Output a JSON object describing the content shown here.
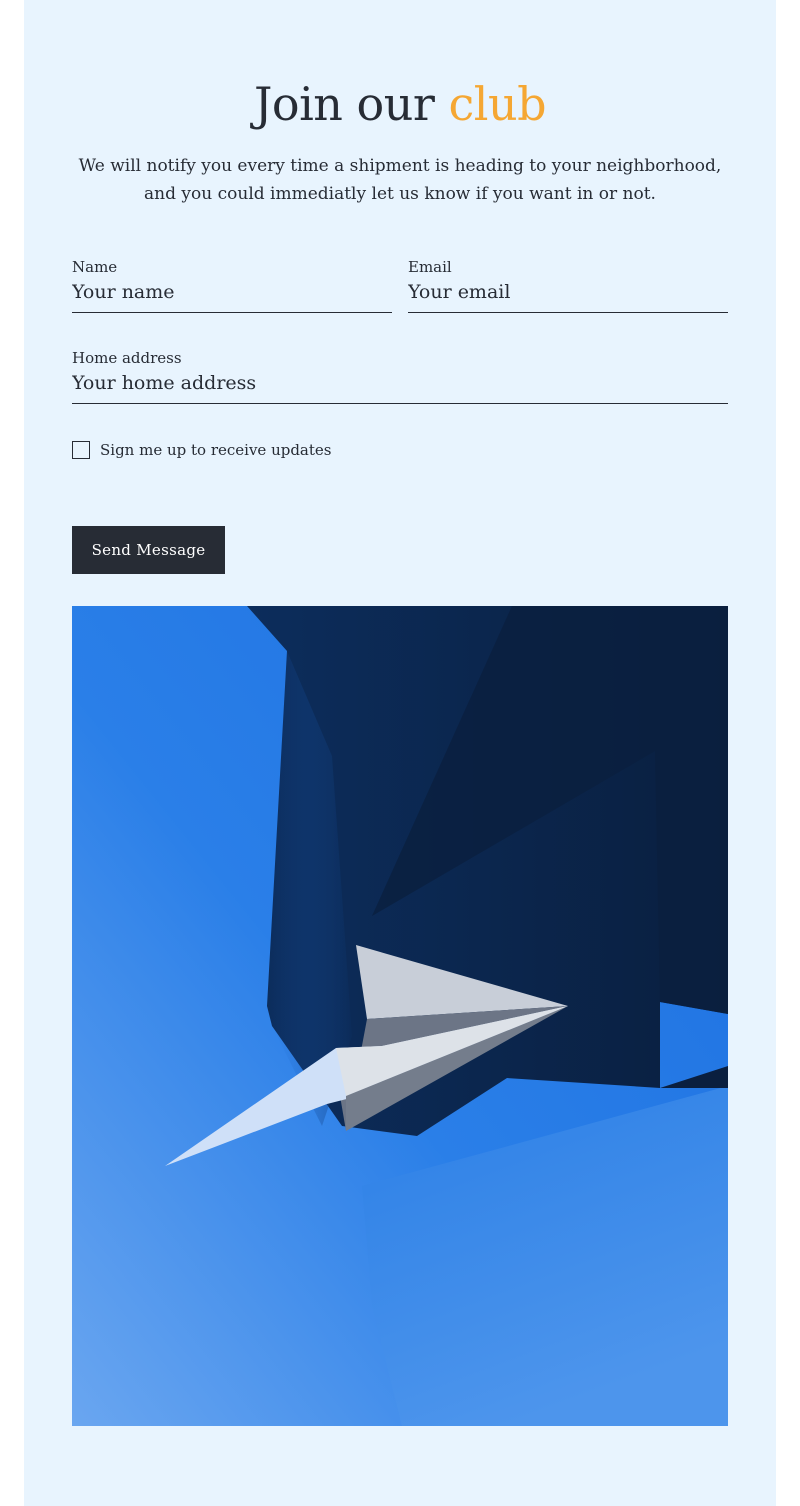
{
  "header": {
    "title_main": "Join our",
    "title_accent": "club",
    "description": "We will notify you every time a shipment is heading to your neighborhood, and you could immediatly let us know if you want in or not."
  },
  "form": {
    "name_label": "Name",
    "name_placeholder": "Your name",
    "email_label": "Email",
    "email_placeholder": "Your email",
    "address_label": "Home address",
    "address_placeholder": "Your home address",
    "updates_label": "Sign me up to receive updates",
    "updates_checked": false,
    "submit_label": "Send Message"
  },
  "colors": {
    "background": "#e8f4fe",
    "text": "#272c35",
    "accent": "#f5a733",
    "button": "#272c35"
  },
  "hero_image": {
    "icon": "paper-plane-illustration"
  }
}
